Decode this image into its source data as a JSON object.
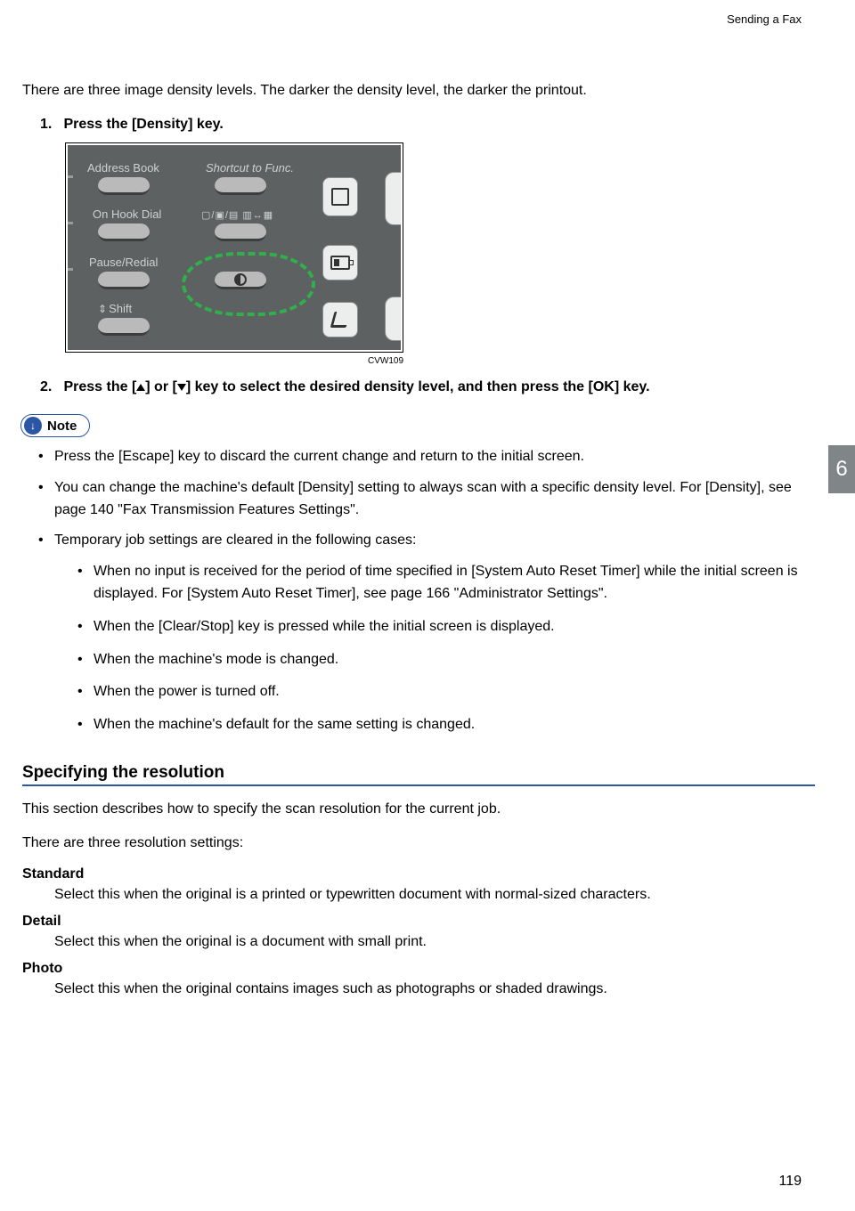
{
  "header": {
    "running_head": "Sending a Fax"
  },
  "intro": "There are three image density levels. The darker the density level, the darker the printout.",
  "steps": [
    {
      "num": "1.",
      "text": "Press the [Density] key."
    },
    {
      "num": "2.",
      "text_pre": "Press the [",
      "text_mid": "] or [",
      "text_post": "] key to select the desired density level, and then press the [OK] key."
    }
  ],
  "panel": {
    "address_book": "Address Book",
    "shortcut": "Shortcut to Func.",
    "on_hook": "On Hook Dial",
    "pause_redial": "Pause/Redial",
    "shift": "Shift",
    "icons_row": "▢/▣/▤ ▥↔▦"
  },
  "figure_code": "CVW109",
  "note_label": "Note",
  "notes": [
    "Press the [Escape] key to discard the current change and return to the initial screen.",
    "You can change the machine's default [Density] setting to always scan with a specific density level. For [Density], see page 140 \"Fax Transmission Features Settings\".",
    "Temporary job settings are cleared in the following cases:"
  ],
  "subnotes": [
    "When no input is received for the period of time specified in [System Auto Reset Timer] while the initial screen is displayed. For [System Auto Reset Timer], see page 166 \"Administrator Settings\".",
    "When the [Clear/Stop] key is pressed while the initial screen is displayed.",
    "When the machine's mode is changed.",
    "When the power is turned off.",
    "When the machine's default for the same setting is changed."
  ],
  "section": {
    "title": "Specifying the resolution",
    "p1": "This section describes how to specify the scan resolution for the current job.",
    "p2": "There are three resolution settings:",
    "defs": [
      {
        "term": "Standard",
        "desc": "Select this when the original is a printed or typewritten document with normal-sized characters."
      },
      {
        "term": "Detail",
        "desc": "Select this when the original is a document with small print."
      },
      {
        "term": "Photo",
        "desc": "Select this when the original contains images such as photographs or shaded drawings."
      }
    ]
  },
  "side_tab": "6",
  "page_number": "119"
}
